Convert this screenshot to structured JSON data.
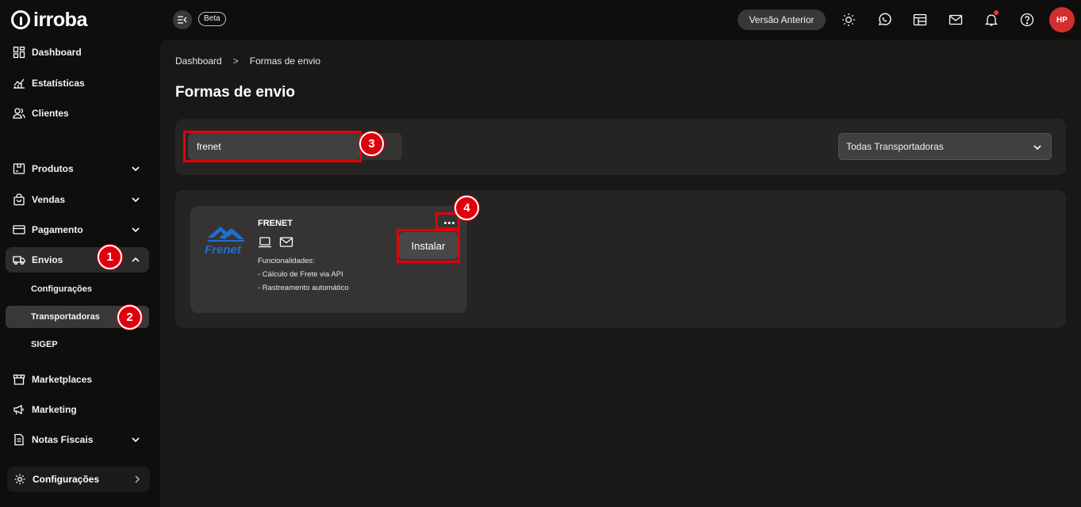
{
  "app": {
    "logo_text": "irroba",
    "beta_label": "Beta"
  },
  "sidebar": {
    "items": [
      {
        "label": "Dashboard",
        "icon": "dashboard-icon"
      },
      {
        "label": "Estatísticas",
        "icon": "chart-icon"
      },
      {
        "label": "Clientes",
        "icon": "users-icon"
      },
      {
        "label": "Produtos",
        "icon": "box-icon"
      },
      {
        "label": "Vendas",
        "icon": "bag-icon"
      },
      {
        "label": "Pagamento",
        "icon": "card-icon"
      },
      {
        "label": "Envios",
        "icon": "truck-icon"
      },
      {
        "label": "Marketplaces",
        "icon": "store-icon"
      },
      {
        "label": "Marketing",
        "icon": "megaphone-icon"
      },
      {
        "label": "Notas Fiscais",
        "icon": "document-icon"
      }
    ],
    "envios_sub": [
      "Configurações",
      "Transportadoras",
      "SIGEP"
    ],
    "bottom_config": "Configurações"
  },
  "header": {
    "versao_anterior": "Versão Anterior",
    "avatar_initials": "HP",
    "icons": [
      "sun-icon",
      "whatsapp-icon",
      "layout-icon",
      "mail-icon",
      "bell-icon",
      "help-icon"
    ]
  },
  "breadcrumb": {
    "items": [
      "Dashboard",
      "Formas de envio"
    ],
    "separator": ">"
  },
  "page": {
    "title": "Formas de envio"
  },
  "filters": {
    "search_value": "frenet",
    "select_value": "Todas Transportadoras"
  },
  "carrier": {
    "logo_text": "Frenet",
    "name": "FRENET",
    "features_title": "Funcionalidades:",
    "features": [
      "- Cálculo de Frete via API",
      "- Rastreamento automático"
    ],
    "install_label": "Instalar"
  },
  "annotations": [
    "1",
    "2",
    "3",
    "4"
  ],
  "colors": {
    "accent_red": "#e0000c",
    "avatar_red": "#d32f2f",
    "frenet_blue": "#1f6fd1"
  }
}
